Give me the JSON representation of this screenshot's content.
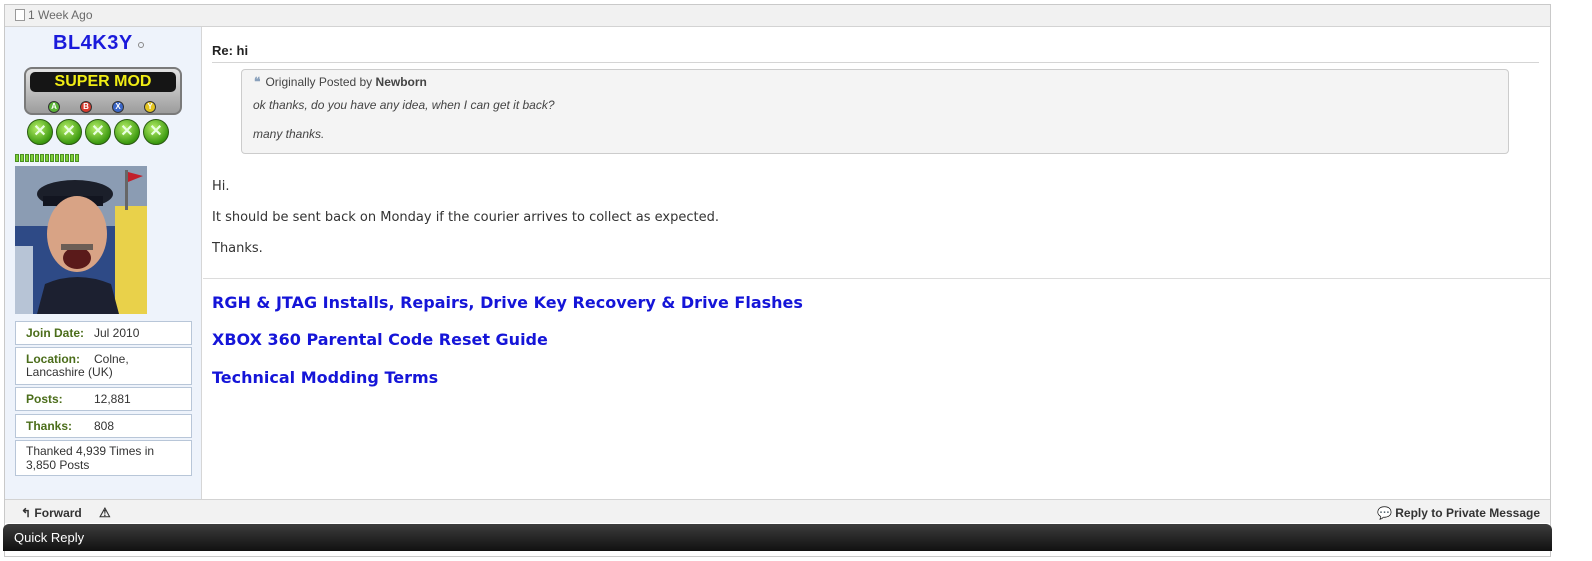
{
  "post": {
    "timestamp": "1 Week Ago",
    "title": "Re: hi",
    "quote": {
      "prefix": "Originally Posted by",
      "author": "Newborn",
      "lines": [
        "ok thanks, do you have any idea, when I can get it back?",
        "many thanks."
      ]
    },
    "body": [
      "Hi.",
      "It should be sent back on Monday if the courier arrives to collect as expected.",
      "Thanks."
    ]
  },
  "user": {
    "name": "BL4K3Y",
    "rank": "SUPER MOD",
    "rank_buttons": [
      "A",
      "B",
      "X",
      "Y"
    ],
    "rank_button_colors": [
      "#5bb337",
      "#d73a2e",
      "#3a66c8",
      "#e3c41f"
    ],
    "info": [
      {
        "label": "Join Date:",
        "value": "Jul 2010"
      },
      {
        "label": "Location:",
        "value": "Colne, Lancashire (UK)"
      },
      {
        "label": "Posts:",
        "value": "12,881"
      },
      {
        "label": "Thanks:",
        "value": "808"
      }
    ],
    "thanked": "Thanked 4,939 Times in 3,850 Posts"
  },
  "signature": {
    "links": [
      "RGH & JTAG Installs, Repairs, Drive Key Recovery & Drive Flashes",
      "XBOX 360 Parental Code Reset Guide",
      "Technical Modding Terms"
    ],
    "link_color": "#1515d8"
  },
  "footer": {
    "forward_label": "Forward",
    "report_icon": "warning-icon",
    "reply_pm_label": "Reply to Private Message"
  },
  "quick_reply": {
    "label": "Quick Reply"
  }
}
